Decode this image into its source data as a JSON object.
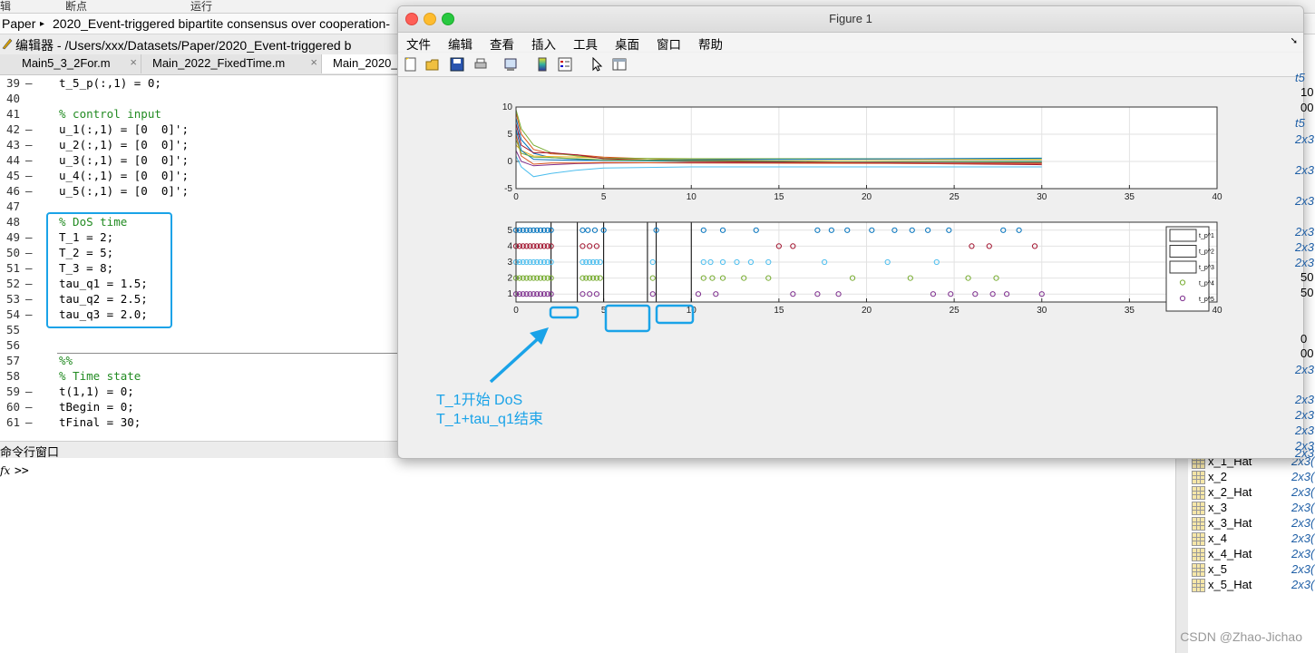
{
  "toolstrip": {
    "items": [
      "辑",
      "断点",
      "运行"
    ]
  },
  "address": {
    "root": "Paper",
    "sep": "▸",
    "path": "2020_Event-triggered bipartite consensus over cooperation-"
  },
  "editor": {
    "title": "编辑器 - /Users/xxx/Datasets/Paper/2020_Event-triggered b",
    "tabs": [
      {
        "label": "Main5_3_2For.m",
        "close": "×"
      },
      {
        "label": "Main_2022_FixedTime.m",
        "close": "×"
      },
      {
        "label": "Main_2020_",
        "close": ""
      }
    ],
    "lines": [
      {
        "n": "39",
        "dash": "–",
        "code": "t_5_p(:,1) = 0;",
        "cmt": false
      },
      {
        "n": "40",
        "dash": "",
        "code": "",
        "cmt": false
      },
      {
        "n": "41",
        "dash": "",
        "code": "% control input",
        "cmt": true
      },
      {
        "n": "42",
        "dash": "–",
        "code": "u_1(:,1) = [0  0]';",
        "cmt": false
      },
      {
        "n": "43",
        "dash": "–",
        "code": "u_2(:,1) = [0  0]';",
        "cmt": false
      },
      {
        "n": "44",
        "dash": "–",
        "code": "u_3(:,1) = [0  0]';",
        "cmt": false
      },
      {
        "n": "45",
        "dash": "–",
        "code": "u_4(:,1) = [0  0]';",
        "cmt": false
      },
      {
        "n": "46",
        "dash": "–",
        "code": "u_5(:,1) = [0  0]';",
        "cmt": false
      },
      {
        "n": "47",
        "dash": "",
        "code": "",
        "cmt": false
      },
      {
        "n": "48",
        "dash": "",
        "code": "% DoS time",
        "cmt": true
      },
      {
        "n": "49",
        "dash": "–",
        "code": "T_1 = 2;",
        "cmt": false
      },
      {
        "n": "50",
        "dash": "–",
        "code": "T_2 = 5;",
        "cmt": false
      },
      {
        "n": "51",
        "dash": "–",
        "code": "T_3 = 8;",
        "cmt": false
      },
      {
        "n": "52",
        "dash": "–",
        "code": "tau_q1 = 1.5;",
        "cmt": false
      },
      {
        "n": "53",
        "dash": "–",
        "code": "tau_q2 = 2.5;",
        "cmt": false
      },
      {
        "n": "54",
        "dash": "–",
        "code": "tau_q3 = 2.0;",
        "cmt": false
      },
      {
        "n": "55",
        "dash": "",
        "code": "",
        "cmt": false
      },
      {
        "n": "56",
        "dash": "",
        "code": "",
        "cmt": false
      },
      {
        "n": "57",
        "dash": "",
        "code": "%%",
        "cmt": true
      },
      {
        "n": "58",
        "dash": "",
        "code": "% Time state",
        "cmt": true
      },
      {
        "n": "59",
        "dash": "–",
        "code": "t(1,1) = 0;",
        "cmt": false
      },
      {
        "n": "60",
        "dash": "–",
        "code": "tBegin = 0;",
        "cmt": false
      },
      {
        "n": "61",
        "dash": "–",
        "code": "tFinal = 30;",
        "cmt": false
      }
    ]
  },
  "command": {
    "title": "命令行窗口",
    "fx": "fx",
    "prompt": ">>"
  },
  "workspace": {
    "rows": [
      {
        "name": "x_1_Hat",
        "value": "2x3("
      },
      {
        "name": "x_2",
        "value": "2x3("
      },
      {
        "name": "x_2_Hat",
        "value": "2x3("
      },
      {
        "name": "x_3",
        "value": "2x3("
      },
      {
        "name": "x_3_Hat",
        "value": "2x3("
      },
      {
        "name": "x_4",
        "value": "2x3("
      },
      {
        "name": "x_4_Hat",
        "value": "2x3("
      },
      {
        "name": "x_5",
        "value": "2x3("
      },
      {
        "name": "x_5_Hat",
        "value": "2x3("
      }
    ],
    "partial_values": [
      "t5",
      "10",
      "00",
      "t5",
      "2x3",
      "2x3",
      "2x3",
      "2x3",
      "2x3",
      "2x3",
      "50",
      "50",
      "0",
      "00",
      "2x3",
      "2x3",
      "2x3",
      "2x3",
      "2x3",
      "2x3"
    ]
  },
  "figure": {
    "title": "Figure 1",
    "menu": [
      "文件",
      "编辑",
      "查看",
      "插入",
      "工具",
      "桌面",
      "窗口",
      "帮助"
    ],
    "toolbar_icons": [
      "new-figure-icon",
      "open-icon",
      "save-icon",
      "print-icon",
      "link-plot-icon",
      "colorbar-icon",
      "legend-icon",
      "pointer-icon",
      "property-editor-icon"
    ],
    "annotation": {
      "line1": "T_1开始 DoS",
      "line2": "T_1+tau_q1结束"
    },
    "colors": {
      "highlight": "#1aa3e8"
    }
  },
  "chart_data": [
    {
      "type": "line",
      "title": "",
      "xlabel": "",
      "ylabel": "",
      "xlim": [
        0,
        40
      ],
      "ylim": [
        -5,
        10
      ],
      "xticks": [
        0,
        5,
        10,
        15,
        20,
        25,
        30,
        35,
        40
      ],
      "yticks": [
        -5,
        0,
        5,
        10
      ],
      "grid": true,
      "series": [
        {
          "color": "#0072bd",
          "x": [
            0,
            0.3,
            1,
            2,
            3.5,
            5,
            10,
            30
          ],
          "y": [
            8,
            4,
            1.5,
            0.7,
            0.4,
            0.2,
            0.0,
            0.0
          ]
        },
        {
          "color": "#d95319",
          "x": [
            0,
            0.3,
            1,
            2,
            3.5,
            5,
            10,
            30
          ],
          "y": [
            9,
            5,
            2.2,
            1.4,
            1.2,
            0.8,
            0.2,
            -0.3
          ]
        },
        {
          "color": "#edb120",
          "x": [
            0,
            0.3,
            1,
            2,
            3.5,
            5,
            10,
            30
          ],
          "y": [
            3,
            2,
            1.0,
            0.9,
            0.8,
            0.6,
            0.4,
            0.3
          ]
        },
        {
          "color": "#7e2f8e",
          "x": [
            0,
            0.3,
            1,
            2,
            3.5,
            5,
            10,
            30
          ],
          "y": [
            2,
            0,
            -0.8,
            -0.6,
            -0.4,
            -0.3,
            -0.2,
            -0.2
          ]
        },
        {
          "color": "#77ac30",
          "x": [
            0,
            0.3,
            1,
            2,
            3.5,
            5,
            10,
            30
          ],
          "y": [
            9.5,
            6,
            3,
            1.6,
            1.0,
            0.6,
            0.5,
            0.5
          ]
        },
        {
          "color": "#4dbeee",
          "x": [
            0,
            0.3,
            1,
            2,
            3.5,
            5,
            10,
            30
          ],
          "y": [
            1,
            -1,
            -2.8,
            -2.2,
            -1.6,
            -1.2,
            -1.0,
            -1.0
          ]
        },
        {
          "color": "#a2142f",
          "x": [
            0,
            0.3,
            1,
            2,
            3.5,
            5,
            10,
            30
          ],
          "y": [
            7,
            3,
            1.6,
            1.6,
            1.2,
            0.5,
            0.0,
            -0.6
          ]
        },
        {
          "color": "#0072bd",
          "x": [
            0,
            0.3,
            1,
            2,
            3.5,
            5,
            10,
            30
          ],
          "y": [
            6,
            2,
            0.4,
            0.3,
            0.2,
            0.2,
            0.3,
            0.6
          ]
        },
        {
          "color": "#d95319",
          "x": [
            0,
            0.3,
            1,
            2,
            3.5,
            5,
            10,
            30
          ],
          "y": [
            5,
            1,
            -0.5,
            -0.3,
            -0.3,
            -0.2,
            -0.3,
            -0.4
          ]
        },
        {
          "color": "#77ac30",
          "x": [
            0,
            0.3,
            1,
            2,
            3.5,
            5,
            10,
            30
          ],
          "y": [
            4,
            1.5,
            0.8,
            0.7,
            0.5,
            0.3,
            0.1,
            -0.1
          ]
        }
      ]
    },
    {
      "type": "scatter",
      "title": "",
      "xlabel": "",
      "ylabel": "",
      "xlim": [
        0,
        40
      ],
      "ylim": [
        0.5,
        5.5
      ],
      "xticks": [
        0,
        5,
        10,
        15,
        20,
        25,
        30,
        35,
        40
      ],
      "yticks": [
        1,
        2,
        3,
        4,
        5
      ],
      "grid": true,
      "dos_lines": [
        2,
        3.5,
        5,
        7.5,
        8,
        10
      ],
      "legend": {
        "placement": "right",
        "entries": [
          "t_p^1",
          "t_p^2",
          "t_p^3",
          "t_p^4",
          "t_p^5"
        ]
      },
      "series": [
        {
          "name": "t_p^1",
          "y": 5,
          "color": "#0072bd",
          "x": [
            0,
            0.2,
            0.4,
            0.6,
            0.8,
            1.0,
            1.2,
            1.4,
            1.6,
            1.8,
            2.0,
            3.8,
            4.1,
            4.5,
            5.0,
            8.0,
            10.7,
            11.8,
            13.7,
            17.2,
            18.0,
            18.9,
            20.3,
            21.6,
            22.6,
            23.5,
            24.7,
            27.8,
            28.7
          ]
        },
        {
          "name": "t_p^2",
          "y": 4,
          "color": "#a2142f",
          "x": [
            0,
            0.2,
            0.4,
            0.6,
            0.8,
            1.0,
            1.2,
            1.4,
            1.6,
            1.8,
            2.0,
            3.8,
            4.2,
            4.6,
            15.0,
            15.8,
            26.0,
            27.0,
            29.6
          ]
        },
        {
          "name": "t_p^3",
          "y": 3,
          "color": "#4dbeee",
          "x": [
            0,
            0.2,
            0.4,
            0.6,
            0.8,
            1.0,
            1.2,
            1.4,
            1.6,
            1.8,
            2.0,
            3.8,
            4.0,
            4.2,
            4.4,
            4.6,
            4.8,
            7.8,
            10.7,
            11.1,
            11.8,
            12.6,
            13.4,
            14.4,
            17.6,
            21.2,
            24.0
          ]
        },
        {
          "name": "t_p^4",
          "y": 2,
          "color": "#77ac30",
          "x": [
            0,
            0.2,
            0.4,
            0.6,
            0.8,
            1.0,
            1.2,
            1.4,
            1.6,
            1.8,
            2.0,
            3.8,
            4.0,
            4.2,
            4.4,
            4.6,
            4.8,
            7.8,
            10.7,
            11.2,
            11.8,
            13.0,
            14.4,
            19.2,
            22.5,
            25.8,
            27.4
          ]
        },
        {
          "name": "t_p^5",
          "y": 1,
          "color": "#7e2f8e",
          "x": [
            0,
            0.2,
            0.4,
            0.6,
            0.8,
            1.0,
            1.2,
            1.4,
            1.6,
            1.8,
            2.0,
            3.8,
            4.2,
            4.6,
            7.8,
            10.4,
            11.4,
            15.8,
            17.2,
            18.4,
            23.8,
            24.8,
            26.2,
            27.2,
            28.0,
            30.0
          ]
        }
      ]
    }
  ]
}
